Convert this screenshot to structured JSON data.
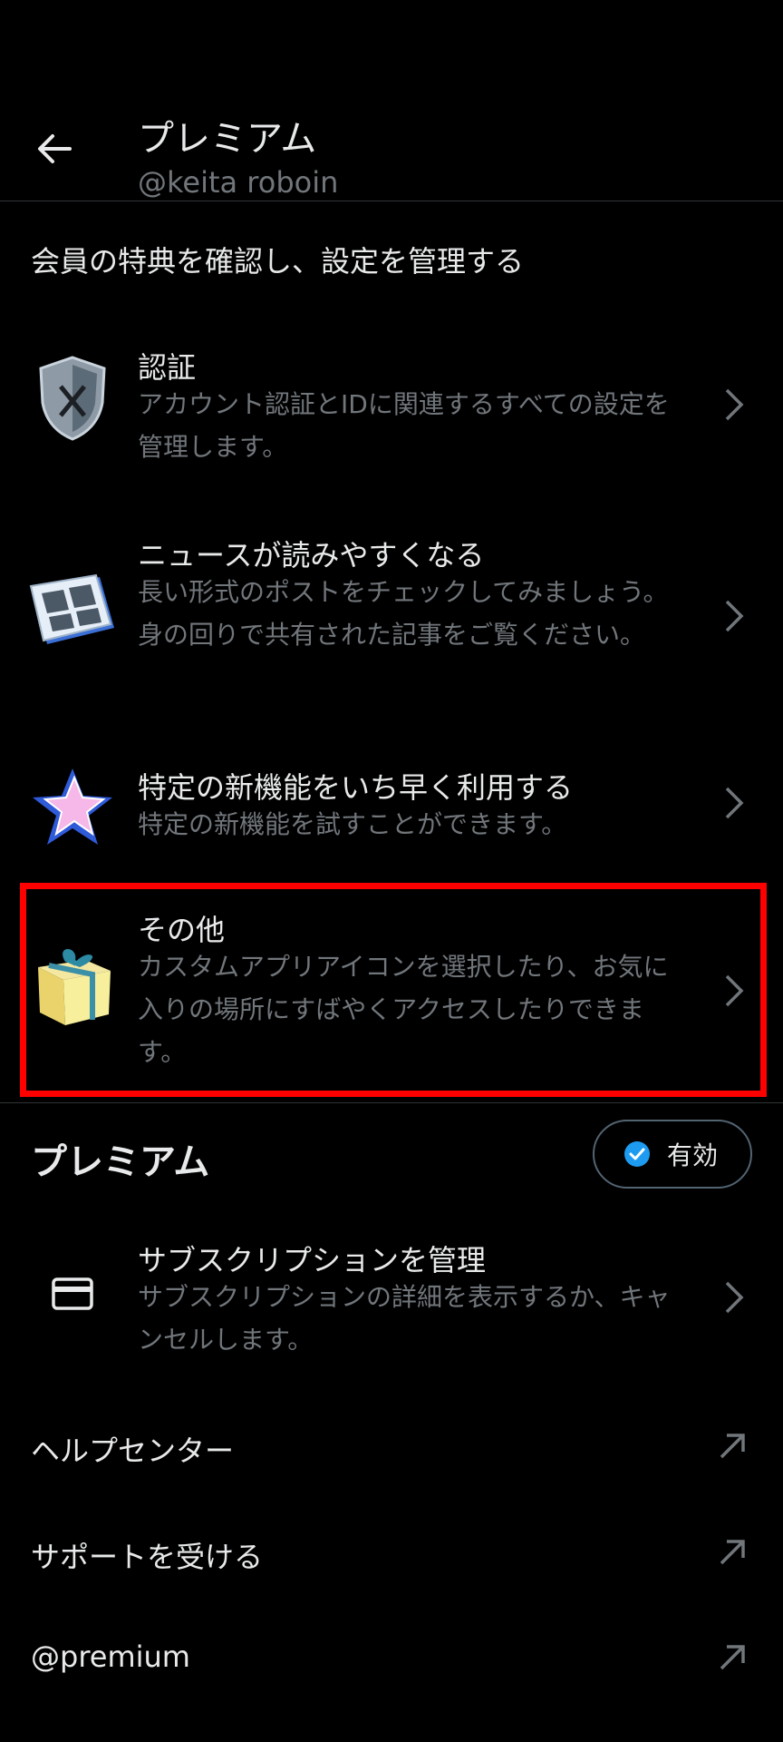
{
  "header": {
    "title": "プレミアム",
    "account": "@keita roboin"
  },
  "intro": "会員の特典を確認し、設定を管理する",
  "features": [
    {
      "title": "認証",
      "desc": "アカウント認証とIDに関連するすべての設定を管理します。",
      "icon": "shield-icon"
    },
    {
      "title": "ニュースが読みやすくなる",
      "desc": "長い形式のポストをチェックしてみましょう。身の回りで共有された記事をご覧ください。",
      "icon": "newspaper-icon"
    },
    {
      "title": "特定の新機能をいち早く利用する",
      "desc": "特定の新機能を試すことができます。",
      "icon": "star-icon"
    },
    {
      "title": "その他",
      "desc": "カスタムアプリアイコンを選択したり、お気に入りの場所にすばやくアクセスしたりできます。",
      "icon": "gift-icon"
    }
  ],
  "premium": {
    "heading": "プレミアム",
    "status": "有効",
    "subscription_title": "サブスクリプションを管理",
    "subscription_desc": "サブスクリプションの詳細を表示するか、キャンセルします。"
  },
  "links": [
    "ヘルプセンター",
    "サポートを受ける",
    "@premium"
  ],
  "colors": {
    "background": "#000000",
    "text": "#e7e9ea",
    "secondary": "#71767b",
    "accent": "#1d9bf0",
    "highlight": "#ff0000"
  }
}
